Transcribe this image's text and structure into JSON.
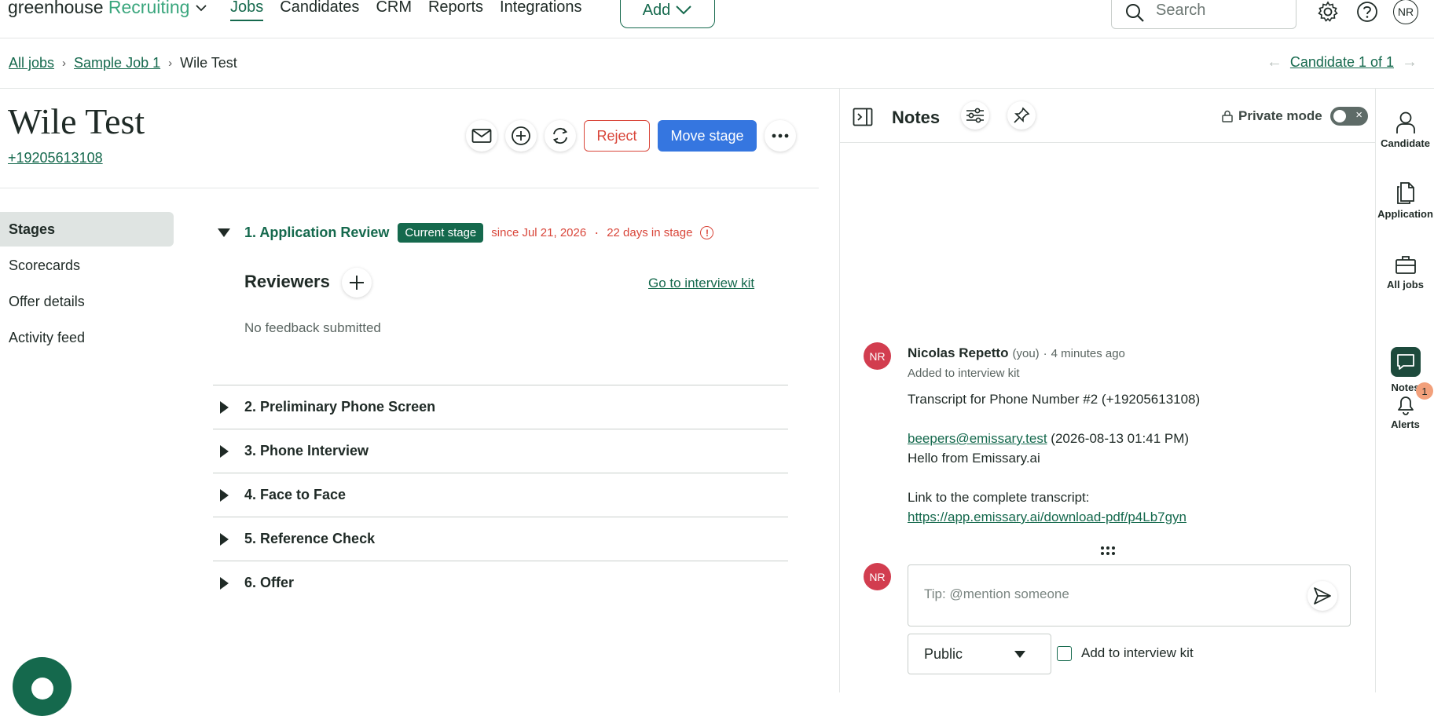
{
  "topnav": {
    "logo_main": "greenhouse",
    "logo_sub": "Recruiting",
    "links": [
      "Jobs",
      "Candidates",
      "CRM",
      "Reports",
      "Integrations"
    ],
    "add_label": "Add",
    "search_placeholder": "Search",
    "user_initials": "NR"
  },
  "breadcrumb": {
    "items": [
      "All jobs",
      "Sample Job 1",
      "Wile Test"
    ],
    "candidate_nav": "Candidate 1 of 1"
  },
  "candidate": {
    "name": "Wile Test",
    "phone": "+19205613108"
  },
  "actions": {
    "reject": "Reject",
    "move_stage": "Move stage"
  },
  "sidenav": {
    "items": [
      "Stages",
      "Scorecards",
      "Offer details",
      "Activity feed"
    ]
  },
  "stages": {
    "current": {
      "title": "1. Application Review",
      "badge": "Current stage",
      "since": "since Jul 21, 2026",
      "days": "22 days in stage",
      "warn_glyph": "!"
    },
    "reviewers_title": "Reviewers",
    "interview_kit_link": "Go to interview kit",
    "no_feedback": "No feedback submitted",
    "others": [
      "2. Preliminary Phone Screen",
      "3. Phone Interview",
      "4. Face to Face",
      "5. Reference Check",
      "6. Offer"
    ]
  },
  "notes": {
    "title": "Notes",
    "private_mode": "Private mode",
    "note": {
      "initials": "NR",
      "author": "Nicolas Repetto",
      "you": "(you)",
      "separator": "·",
      "time": "4 minutes ago",
      "sub": "Added to interview kit",
      "line1": "Transcript for Phone Number #2 (+19205613108)",
      "email": "beepers@emissary.test",
      "email_time": "(2026-08-13 01:41 PM)",
      "line3": "Hello from Emissary.ai",
      "line4": "Link to the complete transcript:",
      "url": "https://app.emissary.ai/download-pdf/p4Lb7gyn"
    },
    "composer_initials": "NR",
    "composer_placeholder": "Tip: @mention someone",
    "visibility": "Public",
    "add_to_kit": "Add to interview kit"
  },
  "rail": {
    "items": [
      "Candidate",
      "Application",
      "All jobs",
      "Notes",
      "Alerts"
    ],
    "alerts_count": "1"
  },
  "colors": {
    "brand_green": "#15694d",
    "danger": "#d9463a",
    "primary_blue": "#3576e0",
    "avatar_red": "#d23d4f"
  }
}
